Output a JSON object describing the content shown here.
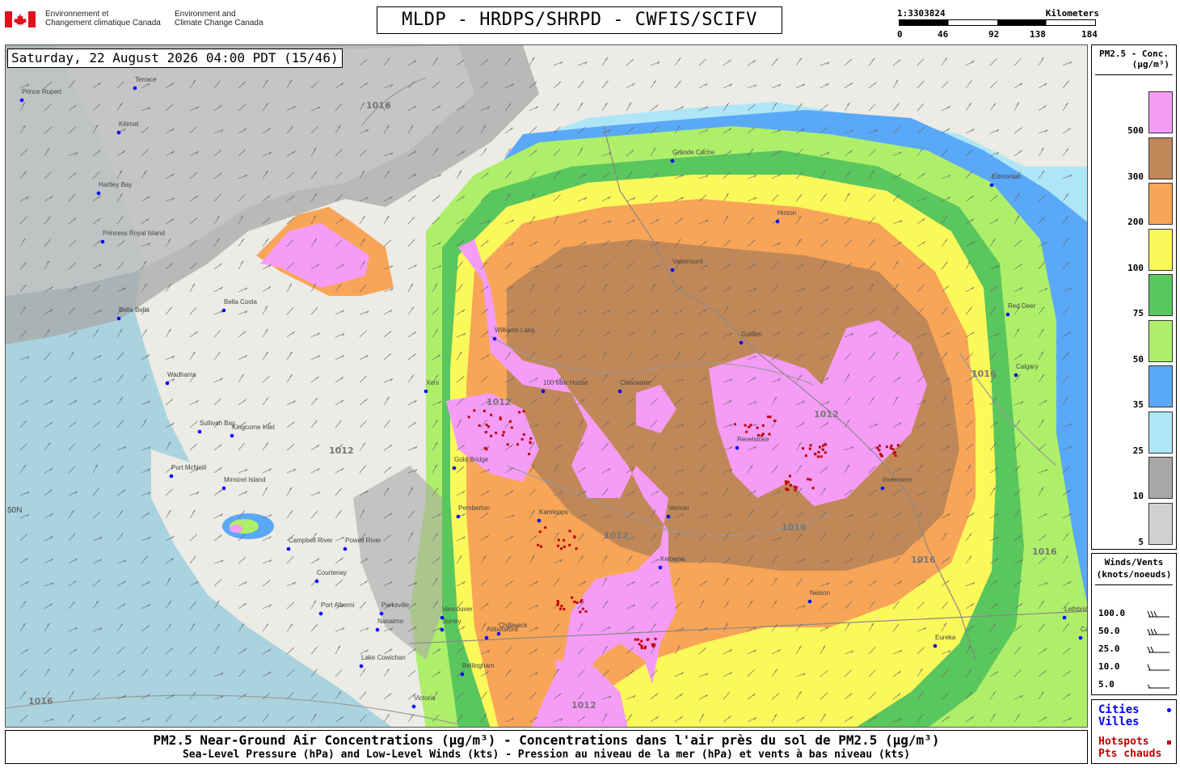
{
  "header": {
    "org_fr": "Environnement et\nChangement climatique Canada",
    "org_en": "Environment and\nClimate Change Canada",
    "title": "MLDP - HRDPS/SHRPD - CWFIS/SCIFV"
  },
  "scale": {
    "ratio": "1:3303824",
    "unit": "Kilometers",
    "ticks": [
      "0",
      "46",
      "92",
      "138",
      "184"
    ]
  },
  "map": {
    "datetime": "Saturday, 22 August 2026 04:00 PDT (15/46)",
    "latitude_label": "50N",
    "place_labels": [
      "Prince Rupert",
      "Terrace",
      "Kitimat",
      "Hartley Bay",
      "Princess Royal Island",
      "Bella Bella",
      "Wadhams",
      "Sullivan Bay",
      "Kingcome Inlet",
      "Port McNeill",
      "Minstrel Island",
      "Campbell River",
      "Powell River",
      "Courtenay",
      "Port Alberni",
      "Parksville",
      "Nanaimo",
      "Lake Cowichan",
      "Victoria",
      "Vancouver",
      "Surrey",
      "Bellingham",
      "Abbotsford",
      "Chilliwack",
      "Pemberton",
      "Gold Bridge",
      "Kamloops",
      "100 Mile House",
      "Clearwater",
      "Williams Lake",
      "Vernon",
      "Kelowna",
      "Revelstoke",
      "Nelson",
      "Invermere",
      "Golden",
      "Grande Cache",
      "Valemount",
      "Edmonton",
      "Red Deer",
      "Calgary",
      "Hinton",
      "Lethbridge",
      "Cardston",
      "Eureka",
      "Xeni",
      "Bella Coola"
    ],
    "isobars": [
      "1016",
      "1012",
      "1012",
      "1016",
      "1012",
      "1016",
      "1016",
      "1012",
      "1016",
      "1016",
      "1012"
    ]
  },
  "pm_legend": {
    "title": "PM2.5 - Conc.",
    "units": "(µg/m³)",
    "levels": [
      {
        "label": "500",
        "color": "#f59cf6"
      },
      {
        "label": "300",
        "color": "#c08858"
      },
      {
        "label": "200",
        "color": "#f8a558"
      },
      {
        "label": "100",
        "color": "#fbf85a"
      },
      {
        "label": "75",
        "color": "#5ac65e"
      },
      {
        "label": "50",
        "color": "#aeef6a"
      },
      {
        "label": "35",
        "color": "#5aa8f8"
      },
      {
        "label": "25",
        "color": "#aee5f7"
      },
      {
        "label": "10",
        "color": "#a8a8a8"
      },
      {
        "label": "5",
        "color": "#d0d0d0"
      }
    ]
  },
  "wind_legend": {
    "title": "Winds/Vents",
    "units": "(knots/noeuds)",
    "speeds": [
      "100.0",
      "50.0",
      "25.0",
      "10.0",
      "5.0"
    ]
  },
  "cities_legend": {
    "cities_en": "Cities",
    "cities_fr": "Villes",
    "hotspots_en": "Hotspots",
    "hotspots_fr": "Pts chauds",
    "city_color": "#0000ff",
    "hotspot_color": "#c00000"
  },
  "footer": {
    "line1": "PM2.5 Near-Ground Air Concentrations (µg/m³) - Concentrations dans l'air près du sol de PM2.5 (µg/m³)",
    "line2": "Sea-Level Pressure (hPa) and Low-Level Winds (kts) - Pression au niveau de la mer (hPa) et vents à bas niveau (kts)"
  }
}
